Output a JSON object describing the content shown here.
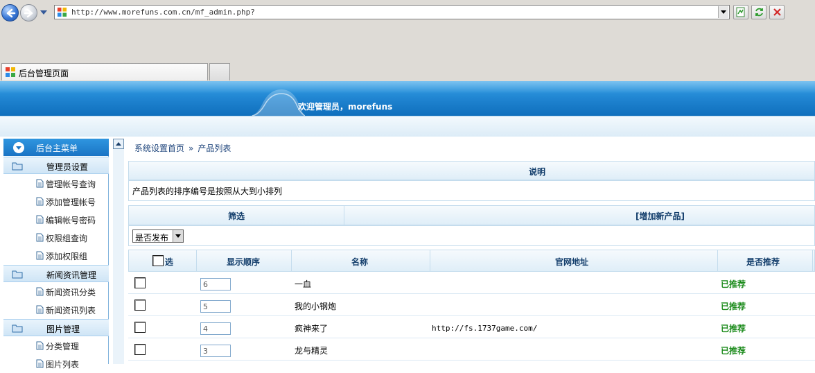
{
  "browser": {
    "url": "http://www.morefuns.com.cn/mf_admin.php?",
    "tab_title": "后台管理页面"
  },
  "header": {
    "welcome": "欢迎管理员，morefuns"
  },
  "sidebar": {
    "main_menu_label": "后台主菜单",
    "groups": [
      {
        "label": "管理员设置",
        "items": [
          "管理帐号查询",
          "添加管理帐号",
          "编辑帐号密码",
          "权限组查询",
          "添加权限组"
        ]
      },
      {
        "label": "新闻资讯管理",
        "items": [
          "新闻资讯分类",
          "新闻资讯列表"
        ]
      },
      {
        "label": "图片管理",
        "items": [
          "分类管理",
          "图片列表"
        ]
      }
    ]
  },
  "main": {
    "breadcrumb": {
      "home": "系统设置首页",
      "sep": "»",
      "current": "产品列表"
    },
    "notice": {
      "title": "说明",
      "text": "产品列表的排序编号是按照从大到小排列"
    },
    "filter": {
      "title": "筛选",
      "add_link": "[增加新产品]",
      "select_value": "是否发布"
    },
    "table": {
      "columns": [
        "选",
        "显示顺序",
        "名称",
        "官网地址",
        "是否推荐"
      ],
      "rows": [
        {
          "order": "6",
          "name": "一血",
          "url": "",
          "recommend": "已推荐"
        },
        {
          "order": "5",
          "name": "我的小钢炮",
          "url": "",
          "recommend": "已推荐"
        },
        {
          "order": "4",
          "name": "疯神来了",
          "url": "http://fs.1737game.com/",
          "recommend": "已推荐"
        },
        {
          "order": "3",
          "name": "龙与精灵",
          "url": "",
          "recommend": "已推荐"
        }
      ]
    }
  },
  "colors": {
    "header_blue": "#1e82cf",
    "recommend_green": "#1a8a1a"
  }
}
